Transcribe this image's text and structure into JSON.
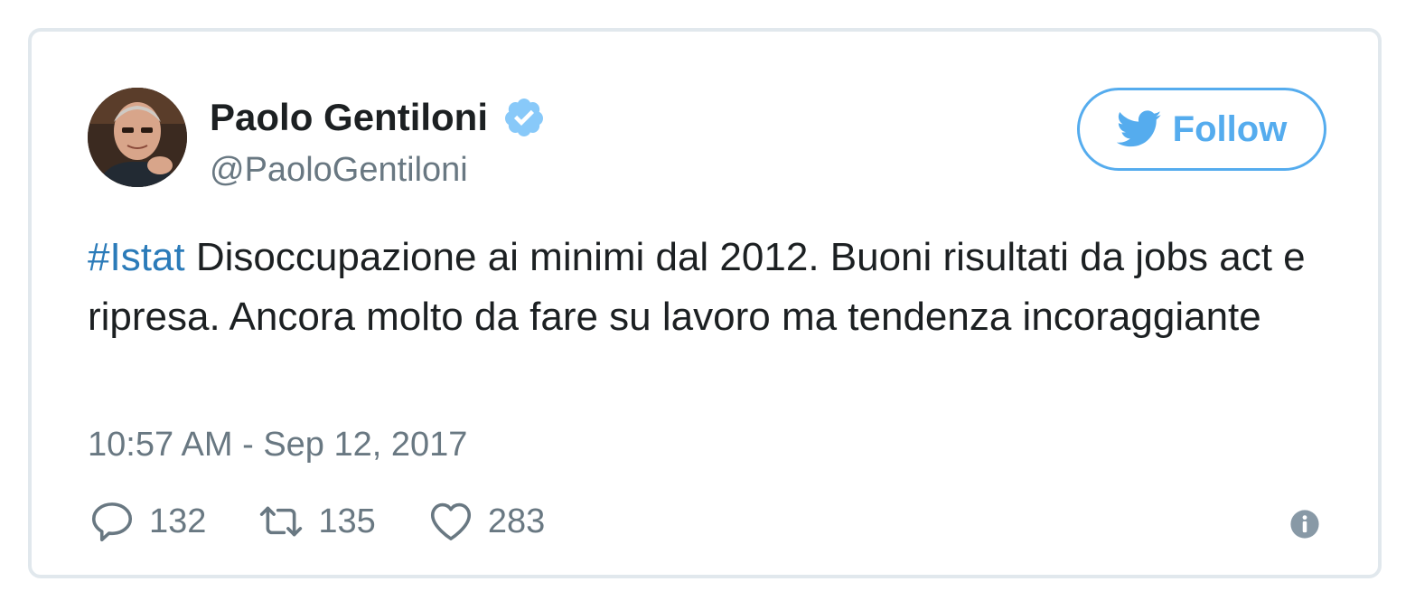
{
  "author": {
    "name": "Paolo Gentiloni",
    "handle": "@PaoloGentiloni",
    "verified": true
  },
  "follow_button": {
    "label": "Follow"
  },
  "tweet": {
    "hashtag": "#Istat",
    "text": " Disoccupazione ai minimi dal 2012. Buoni risultati da jobs act e ripresa. Ancora molto da fare su lavoro ma tendenza incoraggiante",
    "timestamp": "10:57 AM - Sep 12, 2017"
  },
  "actions": {
    "replies": "132",
    "retweets": "135",
    "likes": "283"
  },
  "colors": {
    "accent": "#55acee",
    "hashtag": "#2b7bb9",
    "text": "#1c2022",
    "muted": "#697882",
    "border": "#e1e8ed"
  },
  "icons": {
    "verified": "verified-badge-icon",
    "follow": "twitter-bird-icon",
    "reply": "reply-icon",
    "retweet": "retweet-icon",
    "like": "heart-icon",
    "info": "info-icon"
  }
}
